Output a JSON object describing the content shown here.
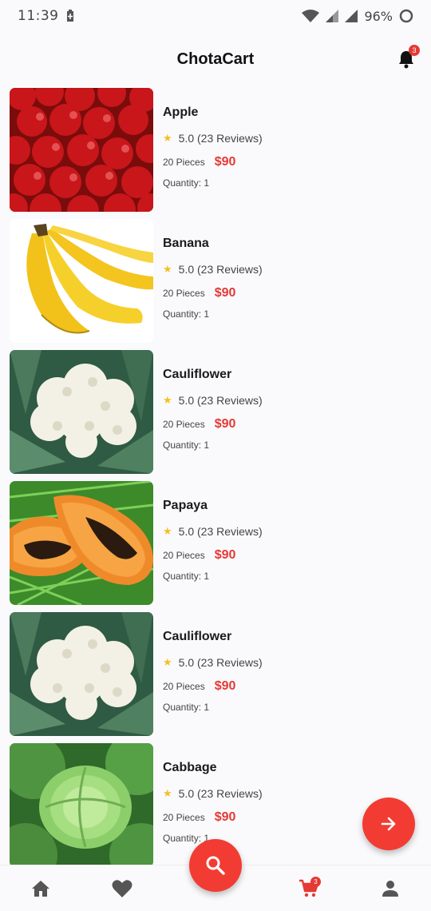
{
  "status_bar": {
    "time": "11:39",
    "battery_percent": "96%"
  },
  "app": {
    "title": "ChotaCart",
    "notification_count": "3"
  },
  "products": [
    {
      "name": "Apple",
      "star": "★",
      "rating": "5.0 (23 Reviews)",
      "pieces": "20 Pieces",
      "price": "$90",
      "quantity": "Quantity: 1",
      "image": "apples"
    },
    {
      "name": "Banana",
      "star": "★",
      "rating": "5.0 (23 Reviews)",
      "pieces": "20 Pieces",
      "price": "$90",
      "quantity": "Quantity: 1",
      "image": "bananas"
    },
    {
      "name": "Cauliflower",
      "star": "★",
      "rating": "5.0 (23 Reviews)",
      "pieces": "20 Pieces",
      "price": "$90",
      "quantity": "Quantity: 1",
      "image": "cauliflower"
    },
    {
      "name": "Papaya",
      "star": "★",
      "rating": "5.0 (23 Reviews)",
      "pieces": "20 Pieces",
      "price": "$90",
      "quantity": "Quantity: 1",
      "image": "papaya"
    },
    {
      "name": "Cauliflower",
      "star": "★",
      "rating": "5.0 (23 Reviews)",
      "pieces": "20 Pieces",
      "price": "$90",
      "quantity": "Quantity: 1",
      "image": "cauliflower"
    },
    {
      "name": "Cabbage",
      "star": "★",
      "rating": "5.0 (23 Reviews)",
      "pieces": "20 Pieces",
      "price": "$90",
      "quantity": "Quantity: 1",
      "image": "cabbage"
    }
  ],
  "bottom_nav": {
    "items": [
      "home-icon",
      "heart-icon",
      "search-icon",
      "cart-icon",
      "person-icon"
    ],
    "cart_count": "3"
  },
  "colors": {
    "accent": "#f23c33",
    "price": "#e53935",
    "star": "#f4c021"
  }
}
